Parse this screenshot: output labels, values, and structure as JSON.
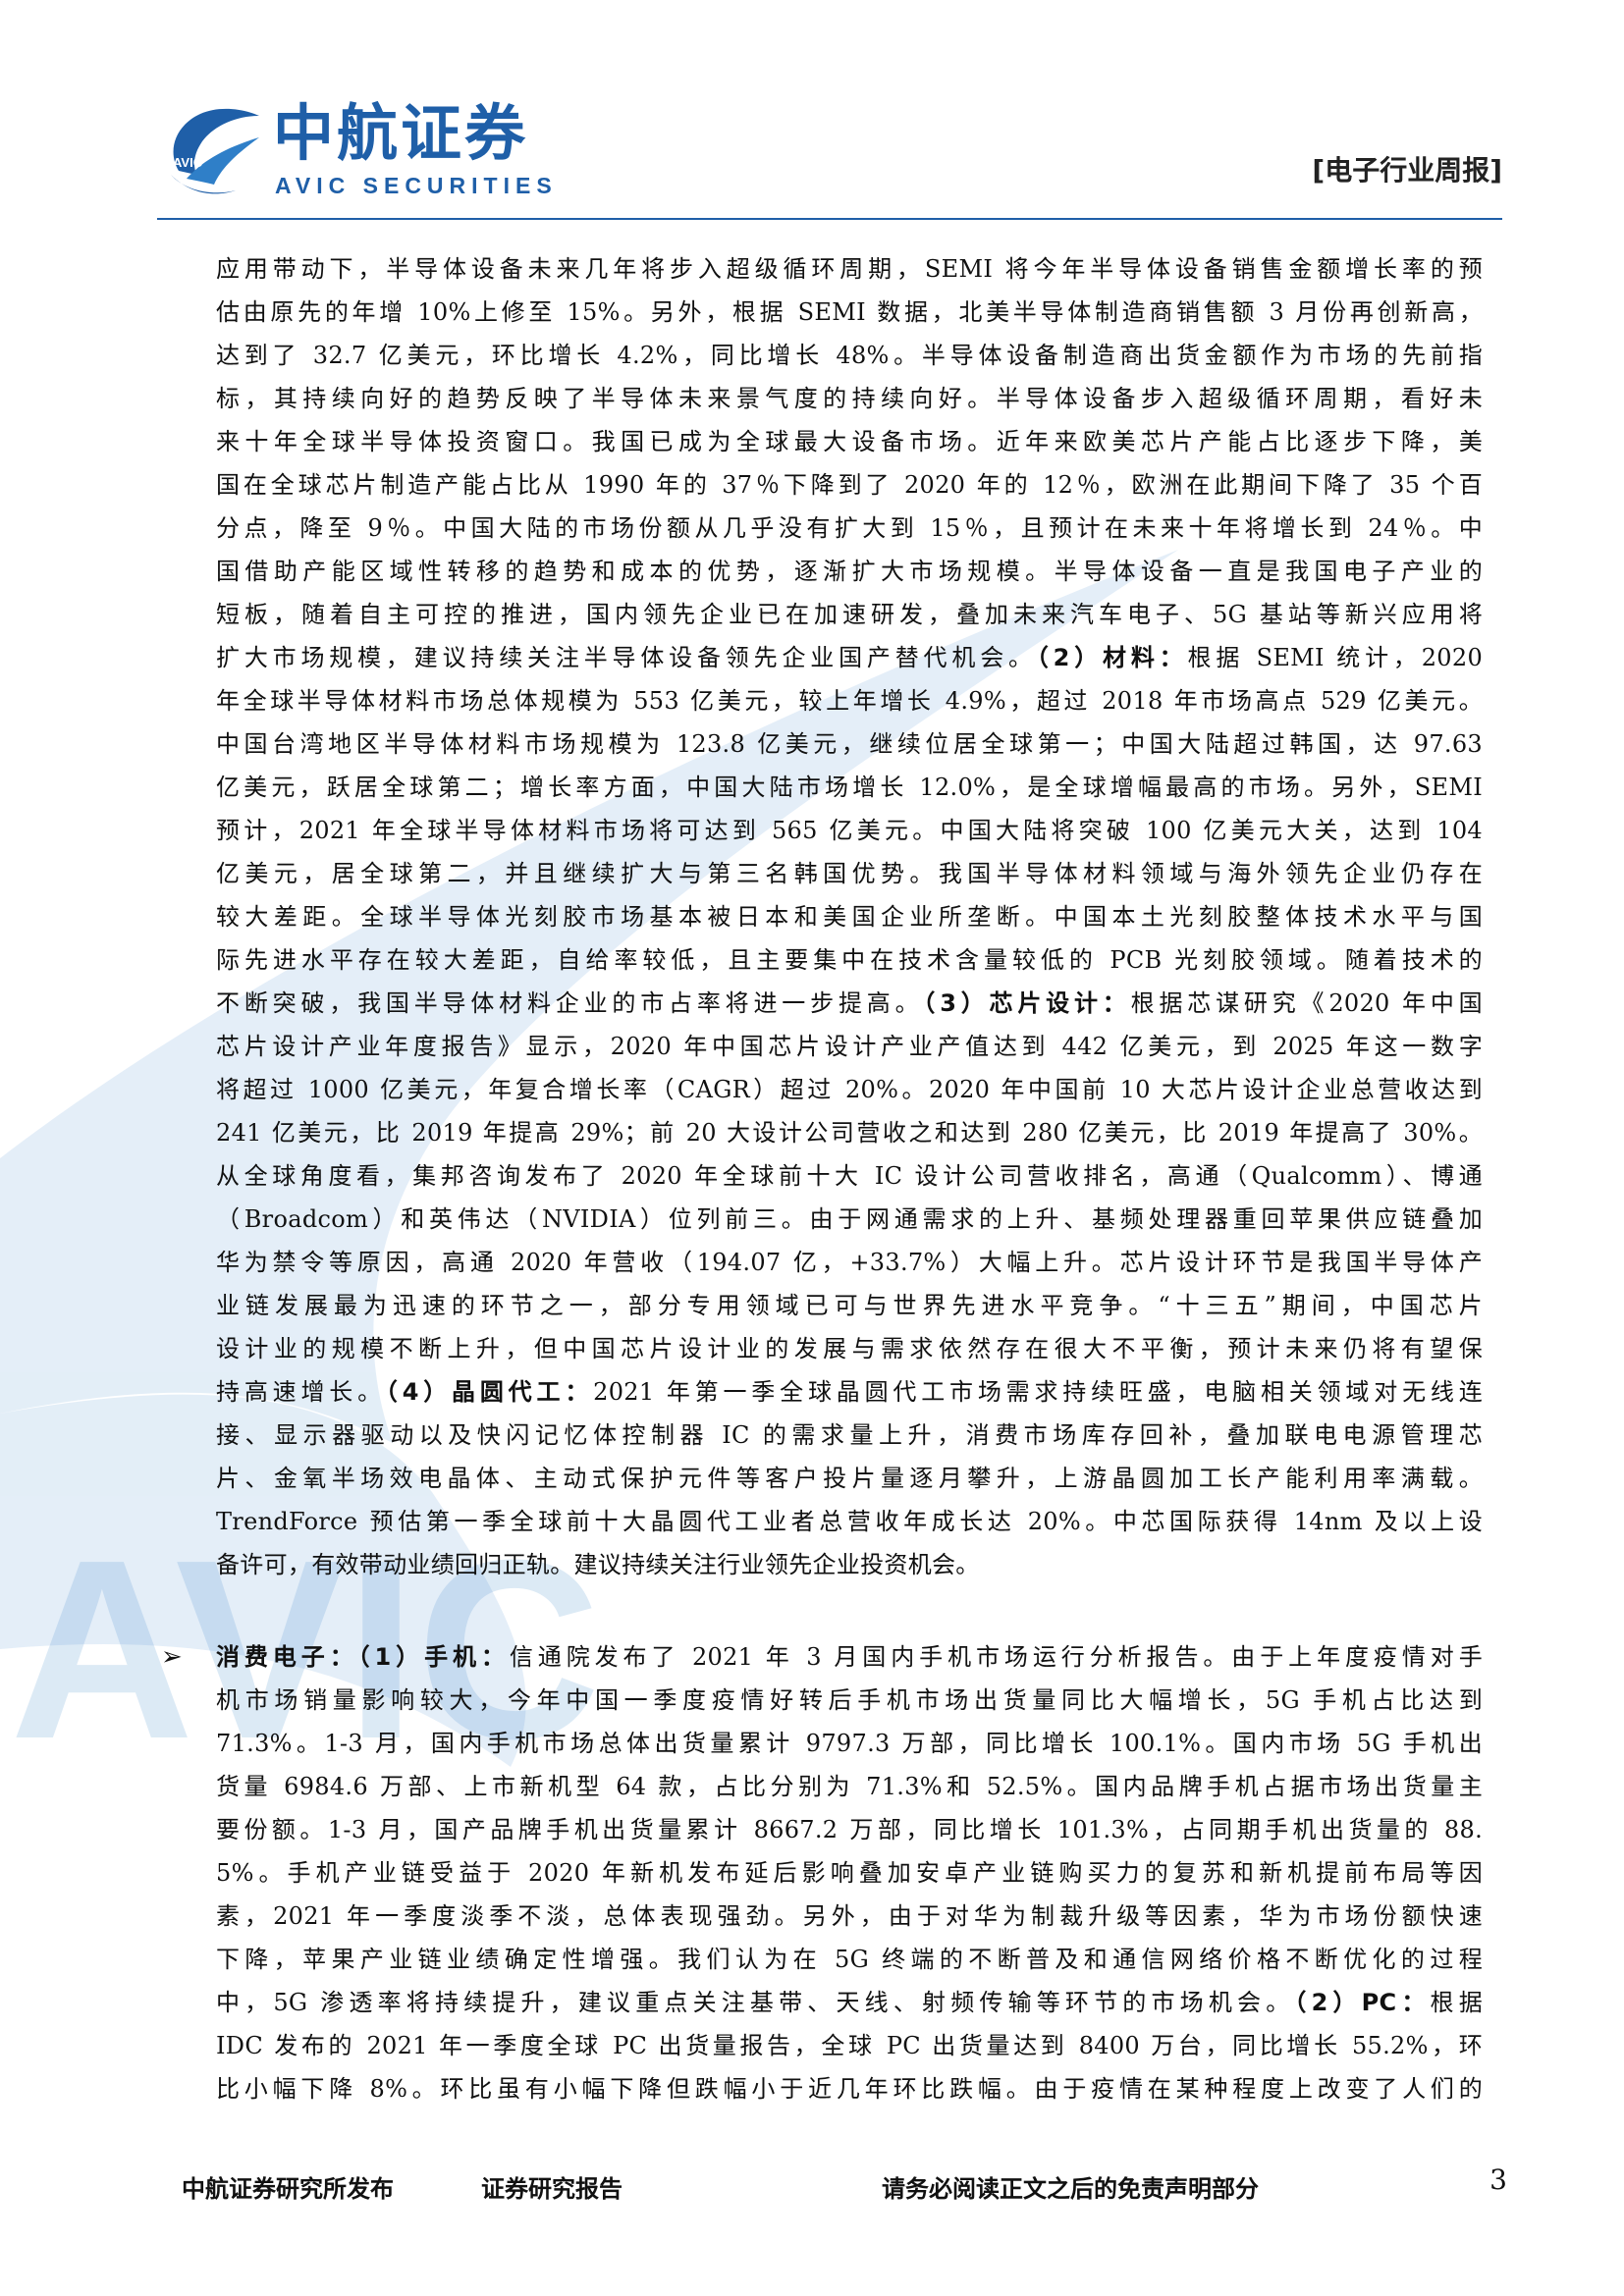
{
  "header": {
    "logo_cn": "中航证券",
    "logo_en": "AVIC SECURITIES",
    "logo_emblem_text": "AVIC",
    "report_type": "[电子行业周报]"
  },
  "watermark_text": "AVIC",
  "body": {
    "p1": [
      "应用带动下，半导体设备未来几年将步入超级循环周期，SEMI 将今年半导体设备销售金额增长率的预",
      "估由原先的年增 10%上修至 15%。另外，根据 SEMI 数据，北美半导体制造商销售额 3 月份再创新高，",
      "达到了 32.7 亿美元，环比增长 4.2%，同比增长 48%。半导体设备制造商出货金额作为市场的先前指",
      "标，其持续向好的趋势反映了半导体未来景气度的持续向好。半导体设备步入超级循环周期，看好未",
      "来十年全球半导体投资窗口。我国已成为全球最大设备市场。近年来欧美芯片产能占比逐步下降，美",
      "国在全球芯片制造产能占比从 1990 年的 37％下降到了 2020 年的 12％，欧洲在此期间下降了 35 个百",
      "分点，降至 9％。中国大陆的市场份额从几乎没有扩大到 15％，且预计在未来十年将增长到 24％。中",
      "国借助产能区域性转移的趋势和成本的优势，逐渐扩大市场规模。半导体设备一直是我国电子产业的",
      "短板，随着自主可控的推进，国内领先企业已在加速研发，叠加未来汽车电子、5G 基站等新兴应用将"
    ],
    "p1_l10_pre": "扩大市场规模，建议持续关注半导体设备领先企业国产替代机会。",
    "p1_l10_bold": "（2）材料：",
    "p1_l10_post": "根据 SEMI 统计，2020",
    "p1_rest": [
      "年全球半导体材料市场总体规模为 553 亿美元，较上年增长 4.9%，超过 2018 年市场高点 529 亿美元。",
      "中国台湾地区半导体材料市场规模为 123.8 亿美元，继续位居全球第一；中国大陆超过韩国，达 97.63",
      "亿美元，跃居全球第二；增长率方面，中国大陆市场增长 12.0%，是全球增幅最高的市场。另外，SEMI",
      "预计，2021 年全球半导体材料市场将可达到 565 亿美元。中国大陆将突破 100 亿美元大关，达到 104",
      "亿美元，居全球第二，并且继续扩大与第三名韩国优势。我国半导体材料领域与海外领先企业仍存在",
      "较大差距。全球半导体光刻胶市场基本被日本和美国企业所垄断。中国本土光刻胶整体技术水平与国",
      "际先进水平存在较大差距，自给率较低，且主要集中在技术含量较低的 PCB 光刻胶领域。随着技术的"
    ],
    "p1_l18_pre": "不断突破，我国半导体材料企业的市占率将进一步提高。",
    "p1_l18_bold": "（3）芯片设计：",
    "p1_l18_post": "根据芯谋研究《2020 年中国",
    "p1_rest2": [
      "芯片设计产业年度报告》显示，2020 年中国芯片设计产业产值达到 442 亿美元，到 2025 年这一数字",
      "将超过 1000 亿美元，年复合增长率（CAGR）超过 20%。2020 年中国前 10 大芯片设计企业总营收达到",
      "241 亿美元，比 2019 年提高 29%；前 20 大设计公司营收之和达到 280 亿美元，比 2019 年提高了 30%。",
      "从全球角度看，集邦咨询发布了 2020 年全球前十大 IC 设计公司营收排名，高通（Qualcomm）、博通",
      "（Broadcom）和英伟达（NVIDIA）位列前三。由于网通需求的上升、基频处理器重回苹果供应链叠加",
      "华为禁令等原因，高通 2020 年营收（194.07 亿，+33.7%）大幅上升。芯片设计环节是我国半导体产",
      "业链发展最为迅速的环节之一，部分专用领域已可与世界先进水平竞争。“十三五”期间，中国芯片",
      "设计业的规模不断上升，但中国芯片设计业的发展与需求依然存在很大不平衡，预计未来仍将有望保"
    ],
    "p1_l27_pre": "持高速增长。",
    "p1_l27_bold": "（4）晶圆代工：",
    "p1_l27_post": "2021 年第一季全球晶圆代工市场需求持续旺盛，电脑相关领域对无线连",
    "p1_rest3": [
      "接、显示器驱动以及快闪记忆体控制器 IC 的需求量上升，消费市场库存回补，叠加联电电源管理芯",
      "片、金氧半场效电晶体、主动式保护元件等客户投片量逐月攀升，上游晶圆加工长产能利用率满载。",
      "TrendForce 预估第一季全球前十大晶圆代工业者总营收年成长达 20%。中芯国际获得 14nm 及以上设"
    ],
    "p1_last": "备许可，有效带动业绩回归正轨。建议持续关注行业领先企业投资机会。",
    "p2_bullet": "➢",
    "p2_l1_bold": "消费电子：（1）手机：",
    "p2_l1_post": "信通院发布了 2021 年 3 月国内手机市场运行分析报告。由于上年度疫情对手",
    "p2_rest": [
      "机市场销量影响较大，今年中国一季度疫情好转后手机市场出货量同比大幅增长，5G 手机占比达到",
      "71.3%。1-3 月，国内手机市场总体出货量累计 9797.3 万部，同比增长 100.1%。国内市场 5G 手机出",
      "货量 6984.6 万部、上市新机型 64 款，占比分别为 71.3%和 52.5%。国内品牌手机占据市场出货量主",
      "要份额。1-3 月，国产品牌手机出货量累计 8667.2 万部，同比增长 101.3%，占同期手机出货量的 88.",
      "5%。手机产业链受益于 2020 年新机发布延后影响叠加安卓产业链购买力的复苏和新机提前布局等因",
      "素，2021 年一季度淡季不淡，总体表现强劲。另外，由于对华为制裁升级等因素，华为市场份额快速",
      "下降，苹果产业链业绩确定性增强。我们认为在 5G 终端的不断普及和通信网络价格不断优化的过程"
    ],
    "p2_l9_pre": "中，5G 渗透率将持续提升，建议重点关注基带、天线、射频传输等环节的市场机会。",
    "p2_l9_bold": "（2）PC：",
    "p2_l9_post": "根据",
    "p2_rest2": [
      "IDC 发布的 2021 年一季度全球 PC 出货量报告，全球 PC 出货量达到 8400 万台，同比增长 55.2%，环",
      "比小幅下降 8%。环比虽有小幅下降但跌幅小于近几年环比跌幅。由于疫情在某种程度上改变了人们的"
    ]
  },
  "footer": {
    "publisher": "中航证券研究所发布",
    "report_kind": "证券研究报告",
    "disclaimer": "请务必阅读正文之后的免责声明部分",
    "page_number": "3"
  }
}
